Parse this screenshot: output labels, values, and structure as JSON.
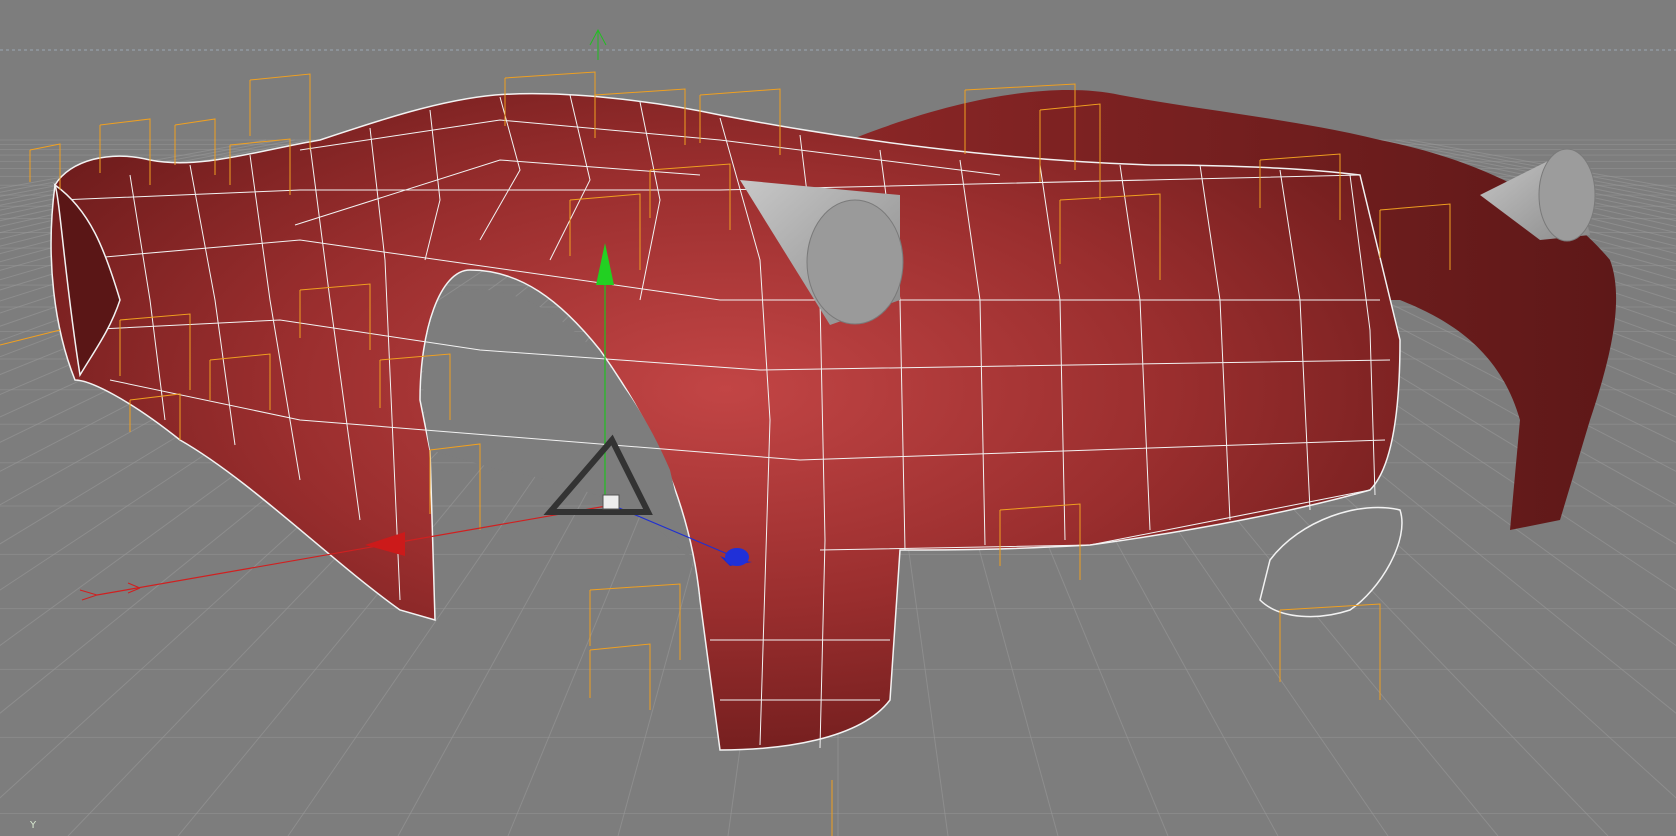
{
  "viewport": {
    "background_color": "#7d7d7d",
    "grid_color": "#9a9a9a",
    "body_color": "#8f2a2a",
    "body_highlight": "#c84a4a",
    "wire_color": "#f2f2f2",
    "spline_color": "#f0a020",
    "pipe_color": "#a8a8a8",
    "axis_corner_label": "Y"
  },
  "gizmo": {
    "x_color": "#d02020",
    "y_color": "#20c020",
    "z_color": "#2030d0",
    "icons": [
      "move-arrow-x-icon",
      "move-arrow-y-icon",
      "move-arrow-z-icon",
      "object-center-cube-icon"
    ]
  }
}
